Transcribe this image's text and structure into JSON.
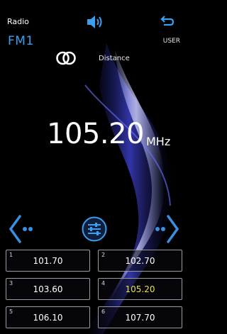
{
  "header": {
    "title": "Radio",
    "band": "FM1",
    "user_label": "USER"
  },
  "status": {
    "distance_label": "Distance"
  },
  "tuner": {
    "frequency": "105.20",
    "unit": "MHz"
  },
  "presets": [
    {
      "num": "1",
      "freq": "101.70",
      "active": false
    },
    {
      "num": "2",
      "freq": "102.70",
      "active": false
    },
    {
      "num": "3",
      "freq": "103.60",
      "active": false
    },
    {
      "num": "4",
      "freq": "105.20",
      "active": true
    },
    {
      "num": "5",
      "freq": "106.10",
      "active": false
    },
    {
      "num": "6",
      "freq": "107.70",
      "active": false
    }
  ],
  "colors": {
    "accent": "#3a9ff0",
    "active_preset": "#e6e04a",
    "border": "#9c9c9c"
  },
  "icons": [
    "speaker-icon",
    "back-arrow-icon",
    "stereo-icon",
    "prev-arrow-icon",
    "next-arrow-icon",
    "equalizer-icon"
  ]
}
